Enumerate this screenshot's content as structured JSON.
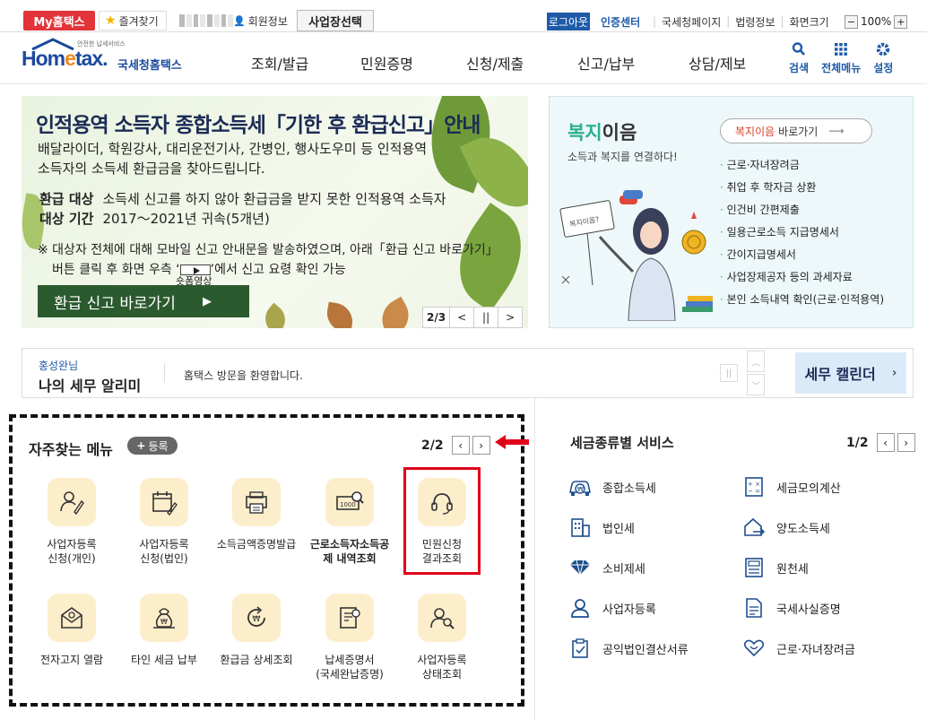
{
  "topbar": {
    "my_hometax": "My홈택스",
    "favorites": "즐겨찾기",
    "member_info": "회원정보",
    "business_select": "사업장선택",
    "logout": "로그아웃",
    "cert_center": "인증센터",
    "links": [
      "국세청페이지",
      "법령정보",
      "화면크기"
    ],
    "zoom_level": "100%",
    "zoom_minus": "−",
    "zoom_plus": "+"
  },
  "header": {
    "logo_small": "안전한 납세서비스",
    "logo_main_a": "Hom",
    "logo_main_b": "e",
    "logo_main_c": "tax.",
    "logo_sub": "국세청홈택스",
    "nav": [
      "조회/발급",
      "민원증명",
      "신청/제출",
      "신고/납부",
      "상담/제보"
    ],
    "icons": [
      {
        "label": "검색",
        "icon": "search-icon"
      },
      {
        "label": "전체메뉴",
        "icon": "grid-menu-icon"
      },
      {
        "label": "설정",
        "icon": "gear-icon"
      }
    ]
  },
  "banner": {
    "title": "인적용역 소득자 종합소득세「기한 후 환급신고」안내",
    "desc1": "배달라이더, 학원강사, 대리운전기사, 간병인, 행사도우미 등 인적용역",
    "desc2": "소득자의 소득세 환급금을 찾아드립니다.",
    "target_label": "환급 대상",
    "target_value": "소득세 신고를 하지 않아 환급금을 받지 못한 인적용역 소득자",
    "period_label": "대상 기간",
    "period_value": "2017～2021년 귀속(5개년)",
    "note1": "※ 대상자 전체에 대해 모바일 신고 안내문을 발송하였으며, 아래「환급 신고 바로가기」",
    "note2_a": "버튼 클릭 후 화면 우측 ‘",
    "note2_b": "’에서 신고 요령 확인 가능",
    "shorts_label": "숏폼영상",
    "button": "환급 신고 바로가기",
    "page": "2/3",
    "prev": "<",
    "pause": "||",
    "next": ">"
  },
  "welfare": {
    "title_a": "복지",
    "title_b": "이음",
    "subtitle": "소득과 복지를 연결하다!",
    "button_a": "복지이음",
    "button_b": " 바로가기",
    "items": [
      "근로·자녀장려금",
      "취업 후 학자금 상환",
      "인건비 간편제출",
      "일용근로소득 지급명세서",
      "간이지급명세서",
      "사업장제공자 등의 과세자료",
      "본인 소득내역 확인(근로·인적용역)"
    ],
    "sign_text": "복지이음?"
  },
  "notice": {
    "name": "홍성완님",
    "title": "나의 세무 알리미",
    "text": "홈택스 방문을 환영합니다.",
    "calendar": "세무 캘린더"
  },
  "favorites": {
    "title": "자주찾는 메뉴",
    "add": "등록",
    "page": "2/2",
    "items": [
      {
        "label": "사업자등록\n신청(개인)",
        "icon": "person-pen-icon"
      },
      {
        "label": "사업자등록\n신청(법인)",
        "icon": "calendar-pen-icon"
      },
      {
        "label": "소득금액증명발급",
        "icon": "printer-icon"
      },
      {
        "label": "근로소득자소득공\n제 내역조회",
        "icon": "money-search-icon"
      },
      {
        "label": "민원신청\n결과조회",
        "icon": "headset-icon"
      },
      {
        "label": "전자고지 열람",
        "icon": "mail-icon"
      },
      {
        "label": "타인 세금 납부",
        "icon": "money-bag-icon"
      },
      {
        "label": "환급금 상세조회",
        "icon": "refund-icon"
      },
      {
        "label": "납세증명서\n(국세완납증명)",
        "icon": "certificate-icon"
      },
      {
        "label": "사업자등록\n상태조회",
        "icon": "person-search-icon"
      }
    ]
  },
  "tax_services": {
    "title": "세금종류별 서비스",
    "page": "1/2",
    "items": [
      {
        "label": "종합소득세",
        "icon": "car-won-icon"
      },
      {
        "label": "세금모의계산",
        "icon": "calculator-icon"
      },
      {
        "label": "법인세",
        "icon": "building-icon"
      },
      {
        "label": "양도소득세",
        "icon": "house-transfer-icon"
      },
      {
        "label": "소비제세",
        "icon": "diamond-icon"
      },
      {
        "label": "원천세",
        "icon": "receipt-icon"
      },
      {
        "label": "사업자등록",
        "icon": "person-icon"
      },
      {
        "label": "국세사실증명",
        "icon": "document-icon"
      },
      {
        "label": "공익법인결산서류",
        "icon": "clipboard-icon"
      },
      {
        "label": "근로·자녀장려금",
        "icon": "heart-hand-icon"
      }
    ]
  },
  "colors": {
    "accent": "#1e5aa8",
    "brand_orange": "#f08a1c",
    "highlight_red": "#e0001a"
  }
}
